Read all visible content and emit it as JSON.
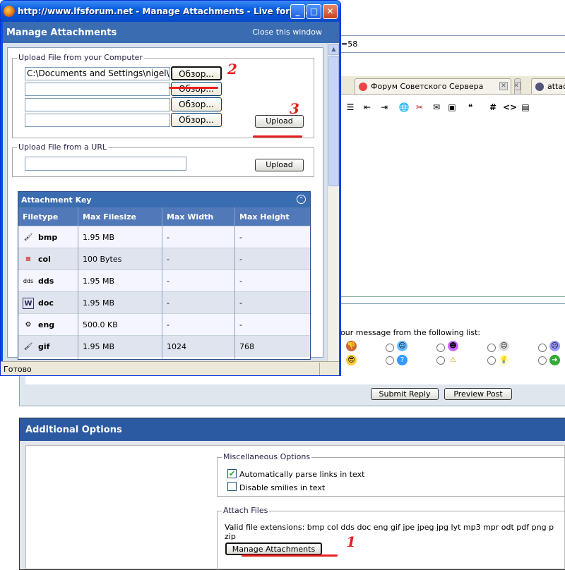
{
  "popup": {
    "title": "http://www.lfsforum.net - Manage Attachments - Live for S...",
    "dialog_title": "Manage Attachments",
    "close_link": "Close this window",
    "upload_computer": {
      "legend": "Upload File from your Computer",
      "file1_value": "C:\\Documents and Settings\\nigel\\R",
      "browse_label": "Обзор...",
      "upload_label": "Upload"
    },
    "upload_url": {
      "legend": "Upload File from a URL",
      "upload_label": "Upload"
    },
    "attachment_key": {
      "title": "Attachment Key",
      "columns": [
        "Filetype",
        "Max Filesize",
        "Max Width",
        "Max Height"
      ],
      "rows": [
        {
          "ext": "bmp",
          "size": "1.95 MB",
          "width": "-",
          "height": "-",
          "icon": "paint-icon"
        },
        {
          "ext": "col",
          "size": "100 Bytes",
          "width": "-",
          "height": "-",
          "icon": "color-icon"
        },
        {
          "ext": "dds",
          "size": "1.95 MB",
          "width": "-",
          "height": "-",
          "icon": "dds-icon"
        },
        {
          "ext": "doc",
          "size": "1.95 MB",
          "width": "-",
          "height": "-",
          "icon": "word-doc-icon"
        },
        {
          "ext": "eng",
          "size": "500.0 KB",
          "width": "-",
          "height": "-",
          "icon": "engine-icon"
        },
        {
          "ext": "gif",
          "size": "1.95 MB",
          "width": "1024",
          "height": "768",
          "icon": "paint-icon"
        }
      ]
    },
    "status": "Готово"
  },
  "background": {
    "url_fragment": "=58",
    "tab1": "Форум Советского Сервера",
    "tab2": "attach",
    "dds_icon_text": "dds",
    "smilies_text": "our message from the following list:",
    "submit_label": "Submit Reply",
    "preview_label": "Preview Post"
  },
  "additional_options": {
    "title": "Additional Options",
    "misc_legend": "Miscellaneous Options",
    "parse_links": "Automatically parse links in text",
    "disable_smilies": "Disable smilies in text",
    "attach_legend": "Attach Files",
    "valid_ext": "Valid file extensions: bmp col dds doc eng gif jpe jpeg jpg lyt mp3 mpr odt pdf png p",
    "valid_ext_cont": "zip",
    "manage_label": "Manage Attachments"
  },
  "annotations": {
    "step1": "1",
    "step2": "2",
    "step3": "3"
  },
  "colors": {
    "accent": "#3a6cb1",
    "annotation": "#e81e1e",
    "xp_title": "#0a5ee0"
  }
}
